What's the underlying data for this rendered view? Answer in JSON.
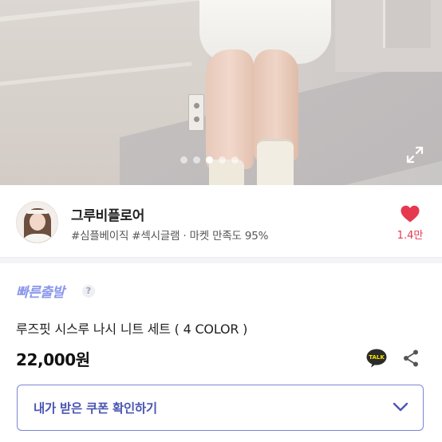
{
  "gallery": {
    "slide_count": 5,
    "active_slide": 3
  },
  "seller": {
    "name": "그루비플로어",
    "tags": "#심플베이직 #섹시글램 · 마켓 만족도 95%",
    "like_count": "1.4만"
  },
  "product": {
    "fast_shipping_label": "빠른출발",
    "help_symbol": "?",
    "title": "루즈핏 시스루 나시 니트 세트 ( 4 COLOR )",
    "price": "22,000원",
    "talk_badge": "TALK"
  },
  "coupon": {
    "label": "내가 받은 쿠폰 확인하기"
  },
  "colors": {
    "accent": "#4b56b3",
    "fast_shipping": "#8a97ec",
    "like": "#e63950",
    "talk_bubble": "#2b2b2b",
    "talk_text": "#f7e600"
  },
  "icons": {
    "expand": "expand-icon",
    "like": "heart-icon",
    "talk": "kakao-talk-icon",
    "share": "share-icon",
    "coupon_toggle": "chevron-down-icon"
  }
}
